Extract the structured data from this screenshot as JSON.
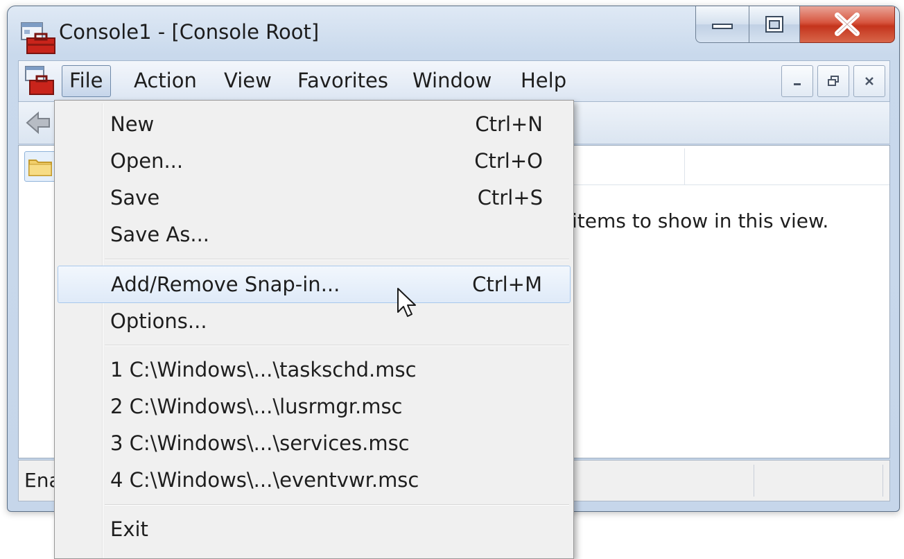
{
  "window": {
    "title": "Console1 - [Console Root]"
  },
  "menubar": {
    "items": [
      "File",
      "Action",
      "View",
      "Favorites",
      "Window",
      "Help"
    ],
    "active": "File"
  },
  "content": {
    "empty_message": "items to show in this view."
  },
  "statusbar": {
    "text": "Ena"
  },
  "file_menu": {
    "group1": [
      {
        "label": "New",
        "shortcut": "Ctrl+N"
      },
      {
        "label": "Open...",
        "shortcut": "Ctrl+O"
      },
      {
        "label": "Save",
        "shortcut": "Ctrl+S"
      },
      {
        "label": "Save As...",
        "shortcut": ""
      }
    ],
    "group2": [
      {
        "label": "Add/Remove Snap-in...",
        "shortcut": "Ctrl+M"
      },
      {
        "label": "Options...",
        "shortcut": ""
      }
    ],
    "recent": [
      {
        "label": "1 C:\\Windows\\...\\taskschd.msc"
      },
      {
        "label": "2 C:\\Windows\\...\\lusrmgr.msc"
      },
      {
        "label": "3 C:\\Windows\\...\\services.msc"
      },
      {
        "label": "4 C:\\Windows\\...\\eventvwr.msc"
      }
    ],
    "exit": {
      "label": "Exit"
    },
    "highlighted": "Add/Remove Snap-in..."
  },
  "icons": {
    "app": "mmc-toolbox-icon",
    "back": "back-arrow-icon",
    "folder": "folder-icon",
    "cursor": "mouse-pointer-icon"
  },
  "colors": {
    "close_button": "#c4341c",
    "highlight_border": "#a8c8ec",
    "frame": "#c9d9ec"
  }
}
